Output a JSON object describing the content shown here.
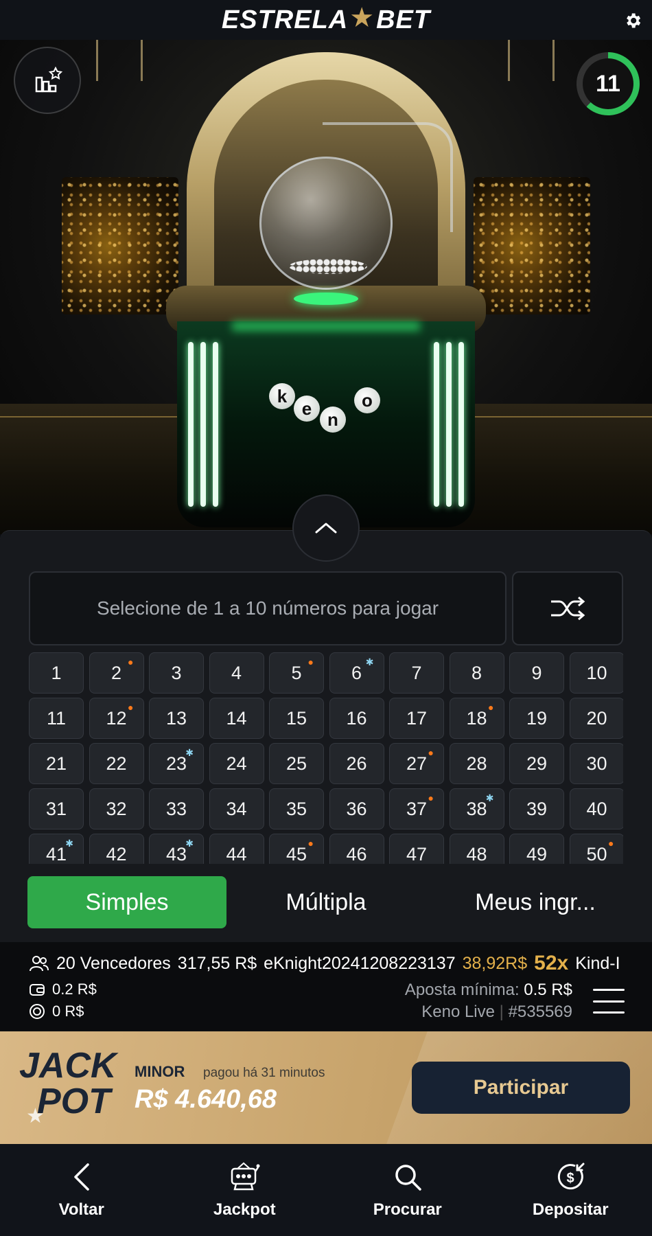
{
  "header": {
    "brand_left": "ESTRELA",
    "brand_right": "BET",
    "settings_icon": "gear-icon"
  },
  "stage": {
    "timer_value": "11",
    "timer_progress": 0.62,
    "keno_letters": [
      "k",
      "e",
      "n",
      "o"
    ]
  },
  "prompt": {
    "text": "Selecione de 1 a 10 números para jogar",
    "shuffle_icon": "shuffle-icon"
  },
  "numbers": [
    {
      "n": "1"
    },
    {
      "n": "2",
      "mark": "hot"
    },
    {
      "n": "3"
    },
    {
      "n": "4"
    },
    {
      "n": "5",
      "mark": "hot"
    },
    {
      "n": "6",
      "mark": "cold"
    },
    {
      "n": "7"
    },
    {
      "n": "8"
    },
    {
      "n": "9"
    },
    {
      "n": "10"
    },
    {
      "n": "11"
    },
    {
      "n": "12",
      "mark": "hot"
    },
    {
      "n": "13"
    },
    {
      "n": "14"
    },
    {
      "n": "15"
    },
    {
      "n": "16"
    },
    {
      "n": "17"
    },
    {
      "n": "18",
      "mark": "hot"
    },
    {
      "n": "19"
    },
    {
      "n": "20"
    },
    {
      "n": "21"
    },
    {
      "n": "22"
    },
    {
      "n": "23",
      "mark": "cold"
    },
    {
      "n": "24"
    },
    {
      "n": "25"
    },
    {
      "n": "26"
    },
    {
      "n": "27",
      "mark": "hot"
    },
    {
      "n": "28"
    },
    {
      "n": "29"
    },
    {
      "n": "30"
    },
    {
      "n": "31"
    },
    {
      "n": "32"
    },
    {
      "n": "33"
    },
    {
      "n": "34"
    },
    {
      "n": "35"
    },
    {
      "n": "36"
    },
    {
      "n": "37",
      "mark": "hot"
    },
    {
      "n": "38",
      "mark": "cold"
    },
    {
      "n": "39"
    },
    {
      "n": "40"
    },
    {
      "n": "41",
      "mark": "cold"
    },
    {
      "n": "42"
    },
    {
      "n": "43",
      "mark": "cold"
    },
    {
      "n": "44"
    },
    {
      "n": "45",
      "mark": "hot"
    },
    {
      "n": "46"
    },
    {
      "n": "47"
    },
    {
      "n": "48"
    },
    {
      "n": "49"
    },
    {
      "n": "50",
      "mark": "hot"
    }
  ],
  "tabs": {
    "simples": "Simples",
    "multipla": "Múltipla",
    "meus": "Meus ingr..."
  },
  "info": {
    "winners": "20 Vencedores",
    "winners_amount": "317,55 R$",
    "ticker_user": "eKnight20241208223137",
    "ticker_amount": "38,92R$",
    "ticker_mult": "52x",
    "ticker_next": "Kind-I",
    "balance": "0.2 R$",
    "bonus": "0 R$",
    "min_bet_label": "Aposta mínima:",
    "min_bet_value": "0.5 R$",
    "game_name": "Keno Live",
    "round_id": "#535569"
  },
  "jackpot": {
    "logo_line1": "JACK",
    "logo_line2": "POT",
    "title": "MINOR",
    "subtitle": "pagou há 31 minutos",
    "amount": "R$ 4.640,68",
    "button": "Participar"
  },
  "nav": {
    "back": "Voltar",
    "jackpot": "Jackpot",
    "search": "Procurar",
    "deposit": "Depositar"
  },
  "colors": {
    "accent_green": "#2fa94a",
    "hot_mark": "#ff7a1a",
    "cold_mark": "#8fd6f2",
    "gold": "#e3b04b"
  }
}
